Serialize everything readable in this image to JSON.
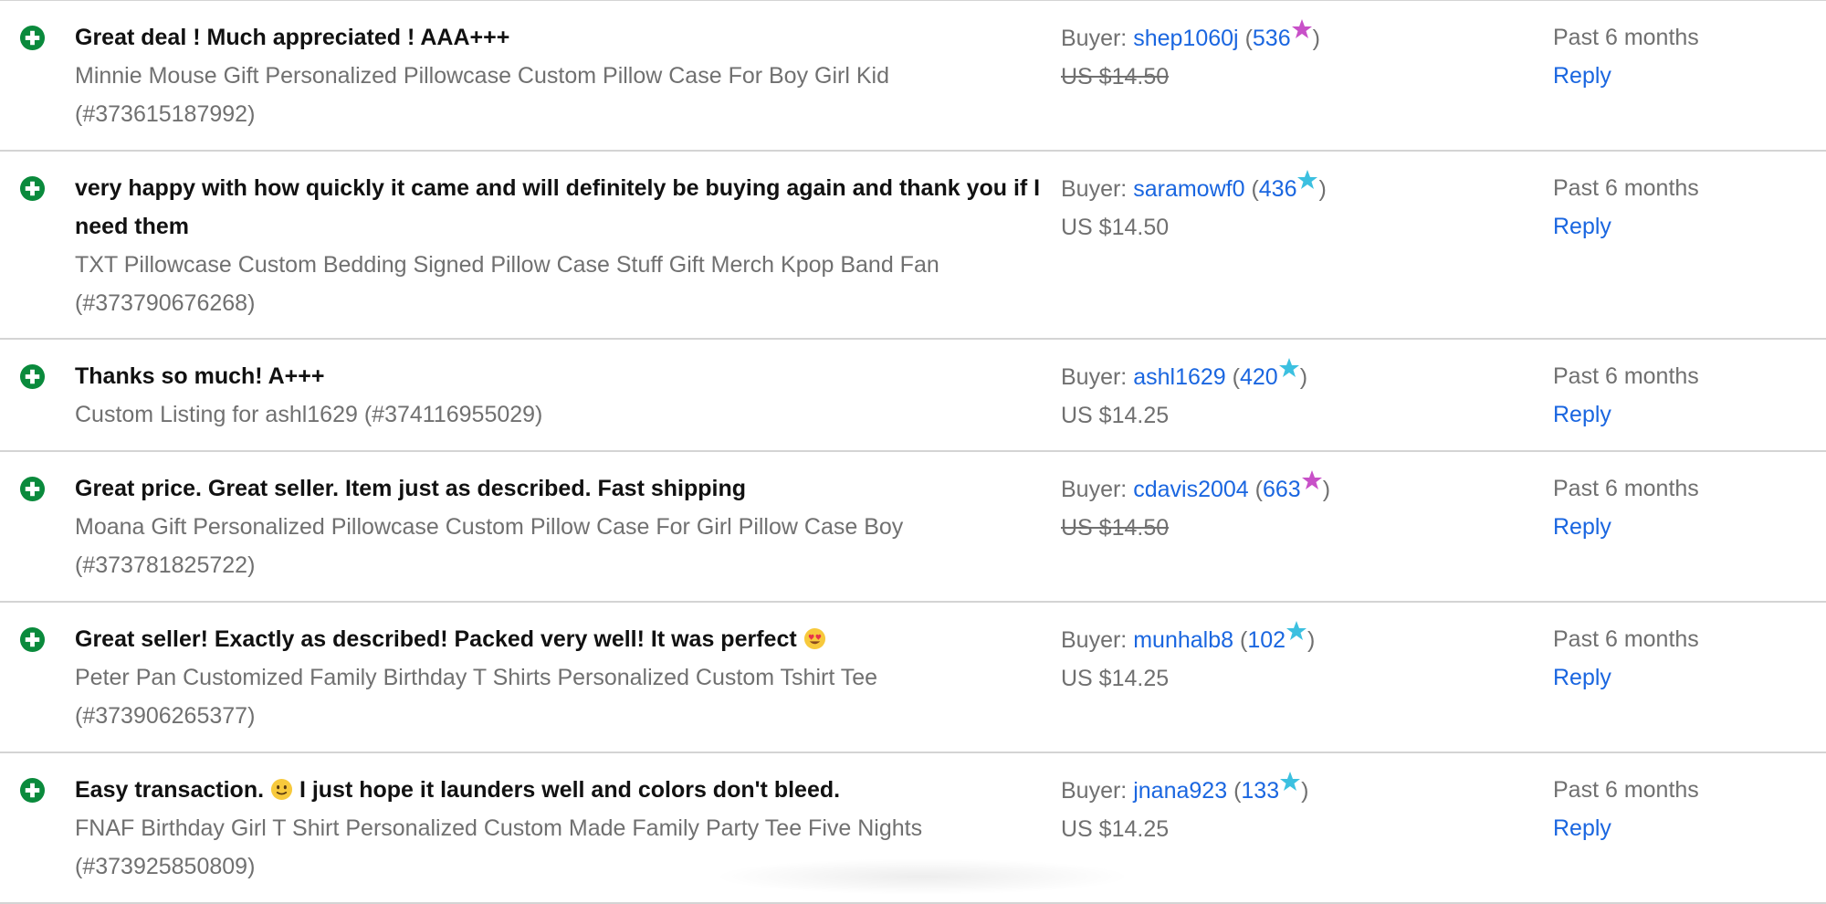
{
  "colors": {
    "positive_icon": "#0a8a3c",
    "link": "#1a66e0",
    "muted_text": "#707070",
    "star_purple": "#c850c8",
    "star_turquoise": "#3cc0e0"
  },
  "feedback": [
    {
      "comment": "Great deal ! Much appreciated ! AAA+++",
      "item": "Minnie Mouse Gift Personalized Pillowcase Custom Pillow Case For Boy Girl Kid (#373615187992)",
      "buyer_label": "Buyer:",
      "buyer": "shep1060j",
      "score": "536",
      "star": "purple",
      "price": "US $14.50",
      "price_struck": true,
      "time": "Past 6 months",
      "reply": "Reply"
    },
    {
      "comment": "very happy with how quickly it came and will definitely be buying again and thank you if I need them",
      "item": "TXT Pillowcase Custom Bedding Signed Pillow Case Stuff Gift Merch Kpop Band Fan (#373790676268)",
      "buyer_label": "Buyer:",
      "buyer": "saramowf0",
      "score": "436",
      "star": "turquoise",
      "price": "US $14.50",
      "price_struck": false,
      "time": "Past 6 months",
      "reply": "Reply"
    },
    {
      "comment": "Thanks so much! A+++",
      "item": "Custom Listing for ashl1629 (#374116955029)",
      "buyer_label": "Buyer:",
      "buyer": "ashl1629",
      "score": "420",
      "star": "turquoise",
      "price": "US $14.25",
      "price_struck": false,
      "time": "Past 6 months",
      "reply": "Reply"
    },
    {
      "comment": "Great price. Great seller. Item just as described. Fast shipping",
      "item": "Moana Gift Personalized Pillowcase Custom Pillow Case For Girl Pillow Case Boy (#373781825722)",
      "buyer_label": "Buyer:",
      "buyer": "cdavis2004",
      "score": "663",
      "star": "purple",
      "price": "US $14.50",
      "price_struck": true,
      "time": "Past 6 months",
      "reply": "Reply"
    },
    {
      "comment": "Great seller! Exactly as described! Packed very well! It was perfect",
      "comment_emoji": "heart-eyes",
      "item": "Peter Pan Customized Family Birthday T Shirts Personalized Custom Tshirt Tee (#373906265377)",
      "buyer_label": "Buyer:",
      "buyer": "munhalb8",
      "score": "102",
      "star": "turquoise",
      "price": "US $14.25",
      "price_struck": false,
      "time": "Past 6 months",
      "reply": "Reply"
    },
    {
      "comment_before": "Easy transaction.",
      "comment_emoji": "slight-smile",
      "comment_after": "I just hope it launders well and colors don't bleed.",
      "item": "FNAF Birthday Girl T Shirt Personalized Custom Made Family Party Tee Five Nights (#373925850809)",
      "buyer_label": "Buyer:",
      "buyer": "jnana923",
      "score": "133",
      "star": "turquoise",
      "price": "US $14.25",
      "price_struck": false,
      "time": "Past 6 months",
      "reply": "Reply"
    }
  ]
}
